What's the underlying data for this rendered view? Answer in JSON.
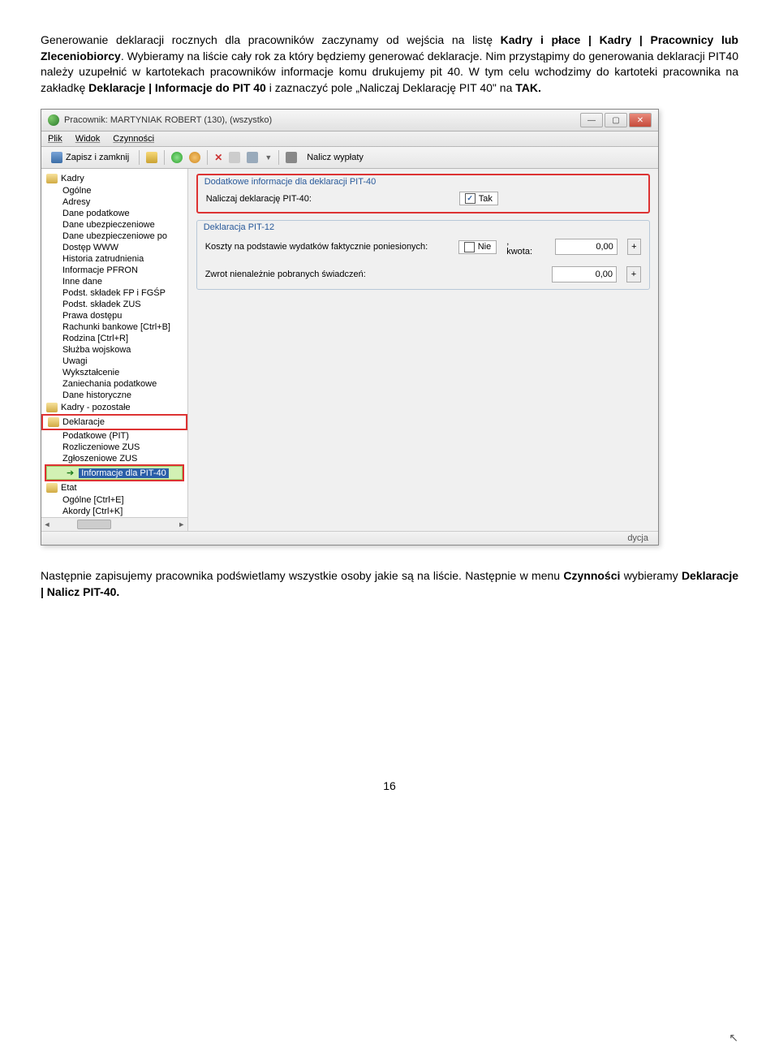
{
  "paragraphs": {
    "p1_a": "Generowanie deklaracji rocznych dla pracowników zaczynamy od wejścia na listę ",
    "p1_b": "Kadry i płace | Kadry | Pracownicy lub Zleceniobiorcy",
    "p1_c": ". Wybieramy na liście cały rok za który będziemy generować deklaracje. Nim przystąpimy do generowania deklaracji PIT40 należy uzupełnić w kartotekach pracowników informacje komu drukujemy pit 40. W tym celu wchodzimy do kartoteki pracownika na zakładkę ",
    "p1_d": "Deklaracje | Informacje do PIT 40",
    "p1_e": " i zaznaczyć  pole „Naliczaj Deklarację PIT 40\" na ",
    "p1_f": "TAK.",
    "p2_a": "Następnie zapisujemy pracownika podświetlamy wszystkie osoby jakie są na liście.  Następnie w menu ",
    "p2_b": "Czynności",
    "p2_c": " wybieramy ",
    "p2_d": "Deklaracje | Nalicz PIT-40."
  },
  "window": {
    "title": "Pracownik: MARTYNIAK ROBERT (130), (wszystko)",
    "menubar": {
      "plik": "Plik",
      "widok": "Widok",
      "czynnosci": "Czynności"
    },
    "toolbar": {
      "save": "Zapisz i zamknij",
      "nalicz": "Nalicz wypłaty"
    },
    "sidebar": {
      "group_kadry": "Kadry",
      "items_kadry": [
        "Ogólne",
        "Adresy",
        "Dane podatkowe",
        "Dane ubezpieczeniowe",
        "Dane ubezpieczeniowe po",
        "Dostęp WWW",
        "Historia zatrudnienia",
        "Informacje PFRON",
        "Inne dane",
        "Podst. składek FP i FGŚP",
        "Podst. składek ZUS",
        "Prawa dostępu",
        "Rachunki bankowe [Ctrl+B]",
        "Rodzina [Ctrl+R]",
        "Służba wojskowa",
        "Uwagi",
        "Wykształcenie",
        "Zaniechania podatkowe",
        "Dane historyczne"
      ],
      "group_pozostale": "Kadry - pozostałe",
      "group_deklaracje": "Deklaracje",
      "items_deklaracje": [
        "Podatkowe (PIT)",
        "Rozliczeniowe ZUS",
        "Zgłoszeniowe ZUS"
      ],
      "item_pit40": "Informacje dla PIT-40",
      "group_etat": "Etat",
      "items_etat": [
        "Ogólne [Ctrl+E]",
        "Akordy [Ctrl+K]"
      ]
    },
    "form": {
      "group1_legend": "Dodatkowe informacje dla deklaracji PIT-40",
      "row1_label": "Naliczaj deklarację PIT-40:",
      "row1_check": "Tak",
      "group2_legend": "Deklaracja PIT-12",
      "row2_label": "Koszty na podstawie wydatków faktycznie poniesionych:",
      "row2_check": "Nie",
      "row2_kwota_lbl": ", kwota:",
      "row2_kwota_val": "0,00",
      "row3_label": "Zwrot nienależnie pobranych świadczeń:",
      "row3_val": "0,00"
    },
    "statusbar": "dycja"
  },
  "page_number": "16"
}
